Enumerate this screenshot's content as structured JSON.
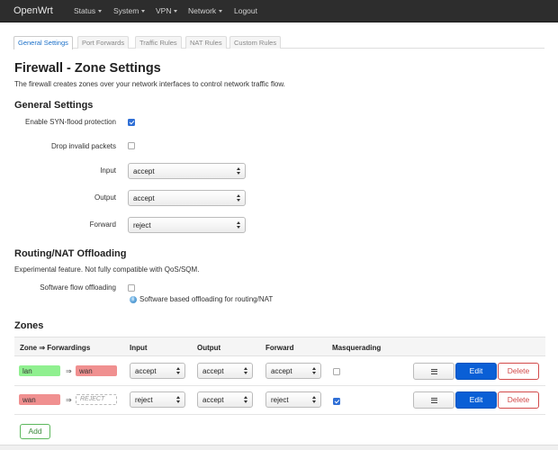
{
  "navbar": {
    "brand": "OpenWrt",
    "items": [
      {
        "label": "Status",
        "dropdown": true
      },
      {
        "label": "System",
        "dropdown": true
      },
      {
        "label": "VPN",
        "dropdown": true
      },
      {
        "label": "Network",
        "dropdown": true
      },
      {
        "label": "Logout",
        "dropdown": false
      }
    ]
  },
  "tabs": [
    {
      "label": "General Settings",
      "active": true
    },
    {
      "label": "Port Forwards",
      "active": false
    },
    {
      "label": "Traffic Rules",
      "active": false
    },
    {
      "label": "NAT Rules",
      "active": false
    },
    {
      "label": "Custom Rules",
      "active": false
    }
  ],
  "page": {
    "title": "Firewall - Zone Settings",
    "description": "The firewall creates zones over your network interfaces to control network traffic flow."
  },
  "general": {
    "heading": "General Settings",
    "syn_flood_label": "Enable SYN-flood protection",
    "syn_flood_checked": true,
    "drop_invalid_label": "Drop invalid packets",
    "drop_invalid_checked": false,
    "input_label": "Input",
    "input_value": "accept",
    "output_label": "Output",
    "output_value": "accept",
    "forward_label": "Forward",
    "forward_value": "reject"
  },
  "offload": {
    "heading": "Routing/NAT Offloading",
    "description": "Experimental feature. Not fully compatible with QoS/SQM.",
    "flow_label": "Software flow offloading",
    "flow_checked": false,
    "flow_help": "Software based offloading for routing/NAT"
  },
  "zones": {
    "heading": "Zones",
    "columns": [
      "Zone ⇒ Forwardings",
      "Input",
      "Output",
      "Forward",
      "Masquerading"
    ],
    "arrow": "⇒",
    "rows": [
      {
        "zone": "lan",
        "forward_to": "wan",
        "input": "accept",
        "output": "accept",
        "forward": "accept",
        "masquerading": false
      },
      {
        "zone": "wan",
        "forward_to": "REJECT",
        "input": "reject",
        "output": "accept",
        "forward": "reject",
        "masquerading": true
      }
    ],
    "edit_label": "Edit",
    "delete_label": "Delete",
    "add_label": "Add"
  },
  "colors": {
    "navbar_bg": "#2d2d2d",
    "primary": "#0a5fd6",
    "danger": "#d24a4a",
    "zone_lan": "#90f090",
    "zone_wan": "#f09090",
    "add_green": "#5cb85c"
  }
}
